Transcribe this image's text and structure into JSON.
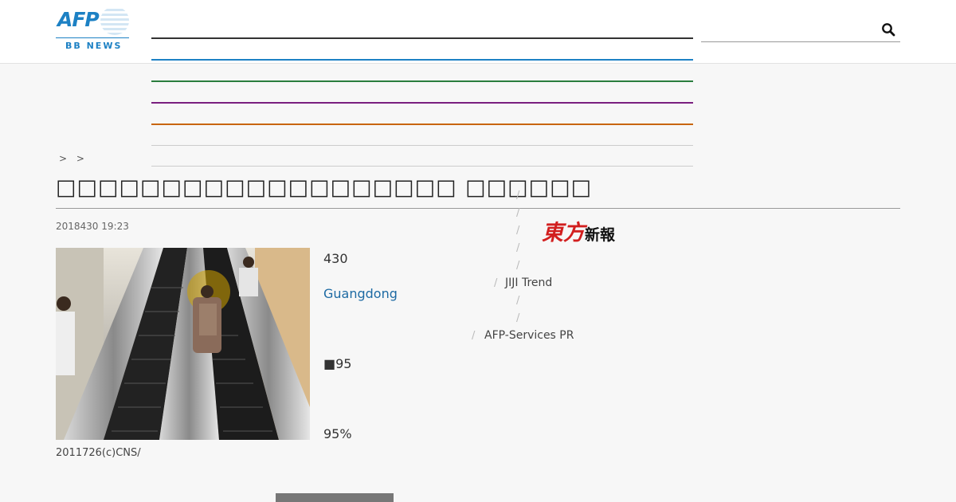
{
  "header": {
    "logo": {
      "brand": "AFP",
      "sub": "BB NEWS"
    },
    "nav_lines": [
      {
        "color": "#333333"
      },
      {
        "color": "#1d81c4"
      },
      {
        "color": "#2a7d3e"
      },
      {
        "color": "#7a1f7f"
      },
      {
        "color": "#c8650a"
      },
      {
        "color": "#cccccc"
      },
      {
        "color": "#cccccc"
      }
    ],
    "search": {
      "placeholder": "",
      "icon": "search-icon"
    }
  },
  "breadcrumb": "> >",
  "article": {
    "title": "□□□□□□□□□□□□□□□□□□□ □□□□□□",
    "date": "2018430 19:23",
    "photo_caption": "2011726(c)CNS/",
    "paragraphs": [
      "430",
      "Guangdong",
      "■95",
      "95%"
    ]
  },
  "sidebar": {
    "separator": "/",
    "logo_red": "東方",
    "logo_black": "新報",
    "links": [
      "JIJI Trend",
      "AFP-Services PR"
    ]
  },
  "colors": {
    "accent": "#1d81c4",
    "link": "#1d6aa3",
    "background": "#f7f7f7"
  }
}
